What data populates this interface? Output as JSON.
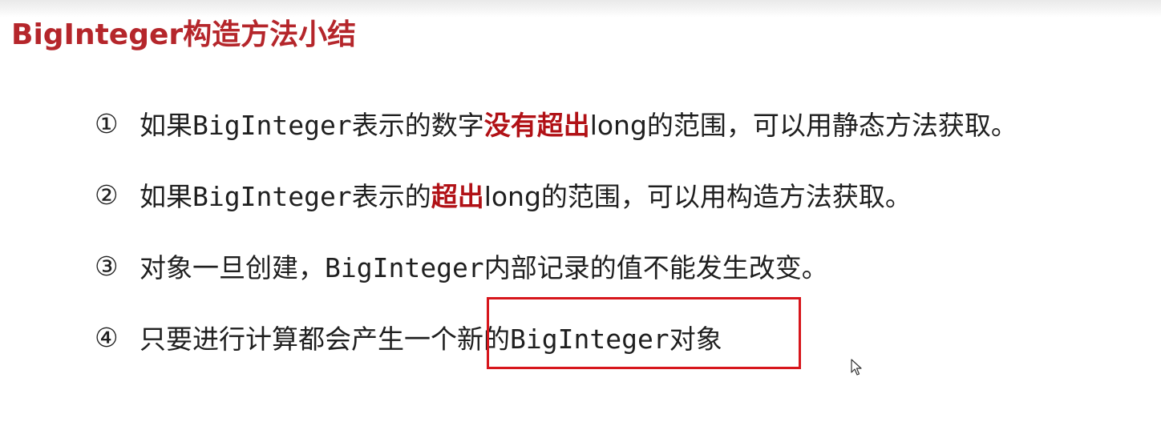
{
  "slide": {
    "title": "BigInteger构造方法小结",
    "items": [
      {
        "number": "①",
        "segments": [
          "如果",
          "BigInteger",
          "表示的数字",
          "没有超出",
          "long",
          "的范围，可以用静态方法获取。"
        ]
      },
      {
        "number": "②",
        "segments": [
          "如果",
          "BigInteger",
          "表示的",
          "超出",
          "long",
          "的范围，可以用构造方法获取。"
        ]
      },
      {
        "number": "③",
        "segments": [
          "对象一旦创建，",
          "BigInteger",
          "内部记录的值不能发生改变。"
        ]
      },
      {
        "number": "④",
        "segments": [
          "只要进行计算都会产生一个新的",
          "BigInteger",
          "对象"
        ]
      }
    ]
  },
  "colors": {
    "title": "#b5262b",
    "emphasis": "#b11116",
    "box": "#d7161c",
    "body_text": "#1f1f1f"
  },
  "icons": {
    "cursor": "mouse-pointer-icon"
  }
}
